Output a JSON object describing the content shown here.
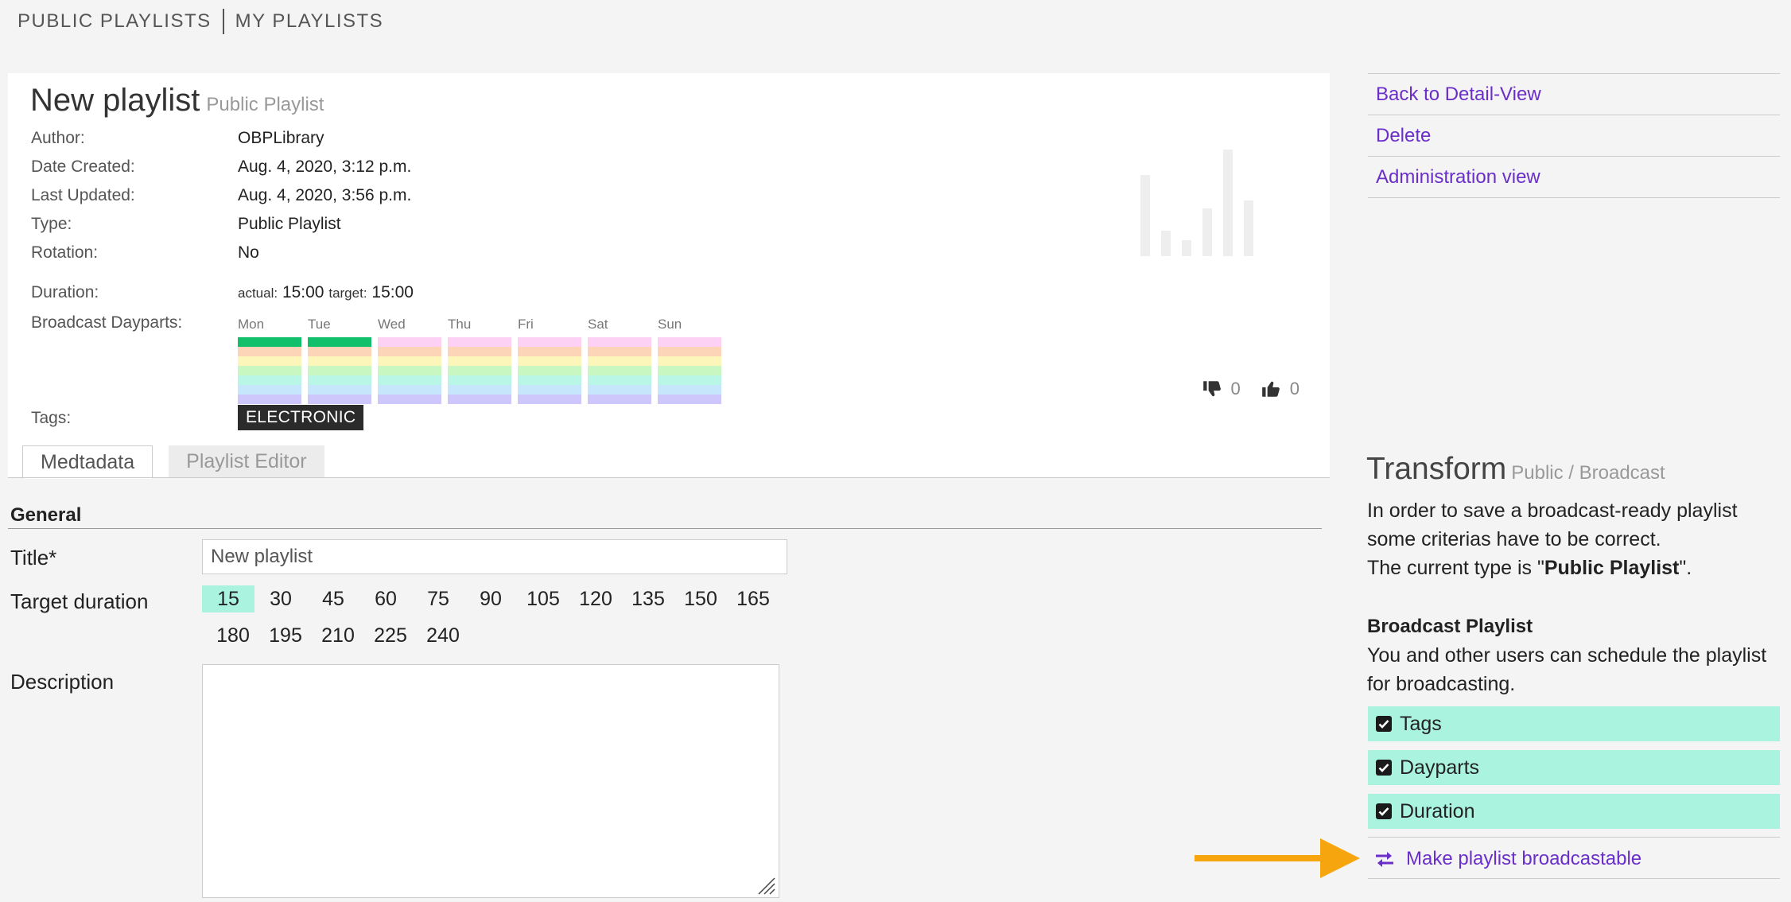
{
  "nav": {
    "public_playlists": "PUBLIC PLAYLISTS",
    "my_playlists": "MY PLAYLISTS"
  },
  "playlist": {
    "title": "New playlist",
    "subtitle": "Public Playlist",
    "labels": {
      "author": "Author:",
      "date_created": "Date Created:",
      "last_updated": "Last Updated:",
      "type": "Type:",
      "rotation": "Rotation:",
      "duration": "Duration:",
      "dayparts": "Broadcast Dayparts:",
      "tags": "Tags:"
    },
    "author": "OBPLibrary",
    "date_created": "Aug. 4, 2020, 3:12 p.m.",
    "last_updated": "Aug. 4, 2020, 3:56 p.m.",
    "type": "Public Playlist",
    "rotation": "No",
    "duration": {
      "actual_label": "actual:",
      "actual": "15:00",
      "target_label": "target:",
      "target": "15:00"
    },
    "days": [
      "Mon",
      "Tue",
      "Wed",
      "Thu",
      "Fri",
      "Sat",
      "Sun"
    ],
    "tag": "ELECTRONIC",
    "votes": {
      "down": "0",
      "up": "0"
    }
  },
  "tabs": {
    "metadata": "Medtadata",
    "editor": "Playlist Editor"
  },
  "form": {
    "section": "General",
    "title_label": "Title*",
    "title_value": "New playlist",
    "target_label": "Target duration",
    "durations_row1": [
      "15",
      "30",
      "45",
      "60",
      "75",
      "90",
      "105",
      "120",
      "135",
      "150",
      "165"
    ],
    "durations_row2": [
      "180",
      "195",
      "210",
      "225",
      "240"
    ],
    "selected_duration": "15",
    "description_label": "Description"
  },
  "sidebar": {
    "links": [
      "Back to Detail-View",
      "Delete",
      "Administration view"
    ]
  },
  "transform": {
    "title": "Transform",
    "subtitle": "Public / Broadcast",
    "text_line1": "In order to save a broadcast-ready playlist",
    "text_line2": "some criterias have to be correct.",
    "text_line3_pre": "The current type is \"",
    "text_line3_type": "Public Playlist",
    "text_line3_post": "\".",
    "bp_title": "Broadcast Playlist",
    "bp_text": "You and other users can schedule the playlist for broadcasting.",
    "criteria": [
      "Tags",
      "Dayparts",
      "Duration"
    ],
    "make_button": "Make playlist broadcastable"
  },
  "colors": {
    "accent": "#6a2ec9",
    "highlight": "#aaf4df",
    "active_daypart": "#12c06b",
    "arrow": "#f6a50f"
  }
}
